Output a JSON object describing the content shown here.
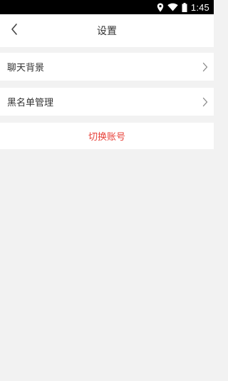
{
  "status_bar": {
    "time": "1:45",
    "icons": [
      "location-icon",
      "wifi-icon",
      "battery-icon"
    ]
  },
  "nav": {
    "title": "设置",
    "back_icon": "chevron-left-icon"
  },
  "settings": {
    "items": [
      {
        "label": "聊天背景",
        "icon": "chevron-right-icon"
      },
      {
        "label": "黑名单管理",
        "icon": "chevron-right-icon"
      }
    ],
    "switch_account_label": "切换账号"
  },
  "colors": {
    "accent_red": "#e8423a",
    "background": "#f2f2f2"
  }
}
